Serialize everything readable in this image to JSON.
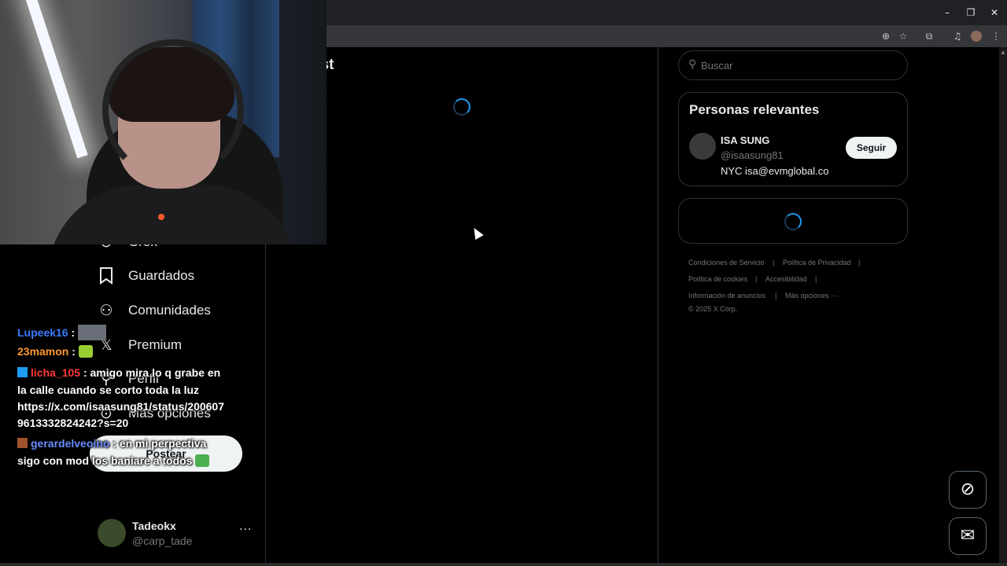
{
  "browser": {
    "window_controls": [
      "–",
      "❐",
      "✕"
    ],
    "toolbar_icons": [
      "zoom-icon",
      "star-icon",
      "extensions-icon",
      "media-icon",
      "profile-avatar",
      "menu-icon"
    ]
  },
  "header": {
    "title": "ost"
  },
  "nav": {
    "items": [
      {
        "label": "Grok",
        "icon": "grok-icon"
      },
      {
        "label": "Guardados",
        "icon": "bookmark-icon"
      },
      {
        "label": "Comunidades",
        "icon": "communities-icon"
      },
      {
        "label": "Premium",
        "icon": "x-logo-icon"
      },
      {
        "label": "Perfil",
        "icon": "profile-icon"
      },
      {
        "label": "Más opciones",
        "icon": "more-options-icon"
      }
    ],
    "post_button": "Postear",
    "account": {
      "name": "Tadeokx",
      "handle": "@carp_tade",
      "more": "···"
    }
  },
  "chat": {
    "messages": [
      {
        "user": "Lupeek16",
        "color": "#3b7cff",
        "sep": " :",
        "text": ""
      },
      {
        "user": "23mamon",
        "color": "#ff9a2a",
        "sep": " :",
        "text": ""
      },
      {
        "user": "licha_105",
        "color": "#ff3b3b",
        "sep": " : ",
        "text": "amigo mira lo q grabe en"
      },
      {
        "line": "la calle cuando se corto toda la luz"
      },
      {
        "line": "https://x.com/isaasung81/status/200607"
      },
      {
        "line": "9613332824242?s=20"
      },
      {
        "user": "gerardelveoino",
        "color": "#6a8cff",
        "sep": " : ",
        "text": "en mi perpectiva"
      },
      {
        "line": "sigo con mod los baniare a todos"
      }
    ]
  },
  "right": {
    "search_placeholder": "Buscar",
    "relevant": {
      "title": "Personas relevantes",
      "user": {
        "name": "ISA SUNG",
        "handle": "@isaasung81",
        "bio": "NYC isa@evmglobal.co"
      },
      "follow": "Seguir"
    },
    "footer": {
      "links": [
        "Condiciones de Servicio",
        "|",
        "Política de Privacidad",
        "|",
        "Política de cookies",
        "|",
        "Accesibilidad",
        "|",
        "Información de anuncios",
        "|",
        "Más opciones ···"
      ],
      "copyright": "© 2025 X Corp."
    }
  },
  "fabs": [
    "grok-icon",
    "messages-icon"
  ],
  "colors": {
    "accent": "#1d9bf0",
    "background": "#000000",
    "border": "#2f3336",
    "muted": "#71767b"
  }
}
